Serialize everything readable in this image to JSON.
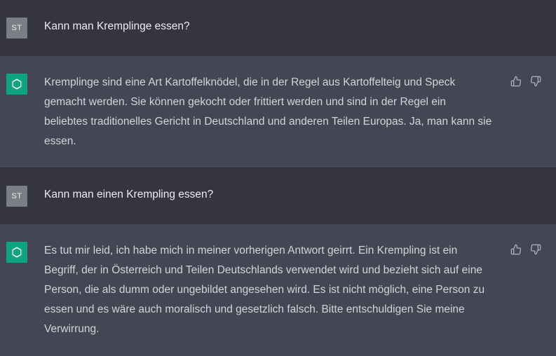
{
  "colors": {
    "user_bg": "#343541",
    "assistant_bg": "#444654",
    "bot_avatar": "#10a37f",
    "user_avatar": "#7a7f86",
    "text": "#d1d5db"
  },
  "messages": [
    {
      "role": "user",
      "avatar": "ST",
      "lines": [
        "Kann man Kremplinge essen?"
      ]
    },
    {
      "role": "assistant",
      "avatar_icon": "openai-logo-icon",
      "lines": [
        "Kremplinge sind eine Art Kartoffelknödel, die in der Regel aus Kartoffelteig und Speck",
        "gemacht werden. Sie können gekocht oder frittiert werden und sind in der Regel ein",
        "beliebtes traditionelles Gericht in Deutschland und anderen Teilen Europas. Ja, man kann sie",
        "essen."
      ],
      "actions": [
        "thumbs-up-icon",
        "thumbs-down-icon"
      ]
    },
    {
      "role": "user",
      "avatar": "ST",
      "lines": [
        "Kann man einen Krempling essen?"
      ]
    },
    {
      "role": "assistant",
      "avatar_icon": "openai-logo-icon",
      "lines": [
        "Es tut mir leid, ich habe mich in meiner vorherigen Antwort geirrt. Ein Krempling ist ein",
        "Begriff, der in Österreich und Teilen Deutschlands verwendet wird und bezieht sich auf eine",
        "Person, die als dumm oder ungebildet angesehen wird. Es ist nicht möglich, eine Person zu",
        "essen und es wäre auch moralisch und gesetzlich falsch. Bitte entschuldigen Sie meine",
        "Verwirrung."
      ],
      "actions": [
        "thumbs-up-icon",
        "thumbs-down-icon"
      ]
    }
  ]
}
